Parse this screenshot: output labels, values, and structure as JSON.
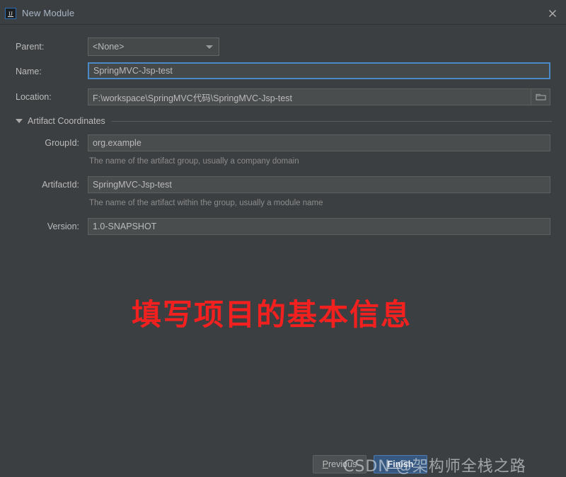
{
  "window": {
    "title": "New Module",
    "app_icon": "intellij-idea-icon",
    "close_icon": "close-icon"
  },
  "form": {
    "parent": {
      "label": "Parent:",
      "value": "<None>",
      "caret_icon": "chevron-down-icon"
    },
    "name": {
      "label": "Name:",
      "value": "SpringMVC-Jsp-test"
    },
    "location": {
      "label": "Location:",
      "value": "F:\\workspace\\SpringMVC代码\\SpringMVC-Jsp-test",
      "browse_icon": "folder-icon"
    },
    "artifact_section": {
      "label": "Artifact Coordinates",
      "expanded": true,
      "toggle_icon": "triangle-down-icon"
    },
    "group_id": {
      "label": "GroupId:",
      "value": "org.example",
      "hint": "The name of the artifact group, usually a company domain"
    },
    "artifact_id": {
      "label": "ArtifactId:",
      "value": "SpringMVC-Jsp-test",
      "hint": "The name of the artifact within the group, usually a module name"
    },
    "version": {
      "label": "Version:",
      "value": "1.0-SNAPSHOT"
    }
  },
  "annotation": {
    "text": "填写项目的基本信息",
    "color": "#f32020"
  },
  "footer": {
    "previous": {
      "mnemonic": "P",
      "rest": "revious"
    },
    "finish": {
      "mnemonic": "Fin",
      "rest": "ish"
    }
  },
  "watermark": {
    "text": "CSDN @架构师全栈之路"
  },
  "colors": {
    "dialog_bg": "#3c3f41",
    "field_bg": "#45494a",
    "field_border": "#646464",
    "focus_border": "#4a88c7",
    "primary_button": "#365880",
    "text": "#bbbbbb",
    "hint_text": "#8c8c8c",
    "annotation_red": "#f32020"
  }
}
